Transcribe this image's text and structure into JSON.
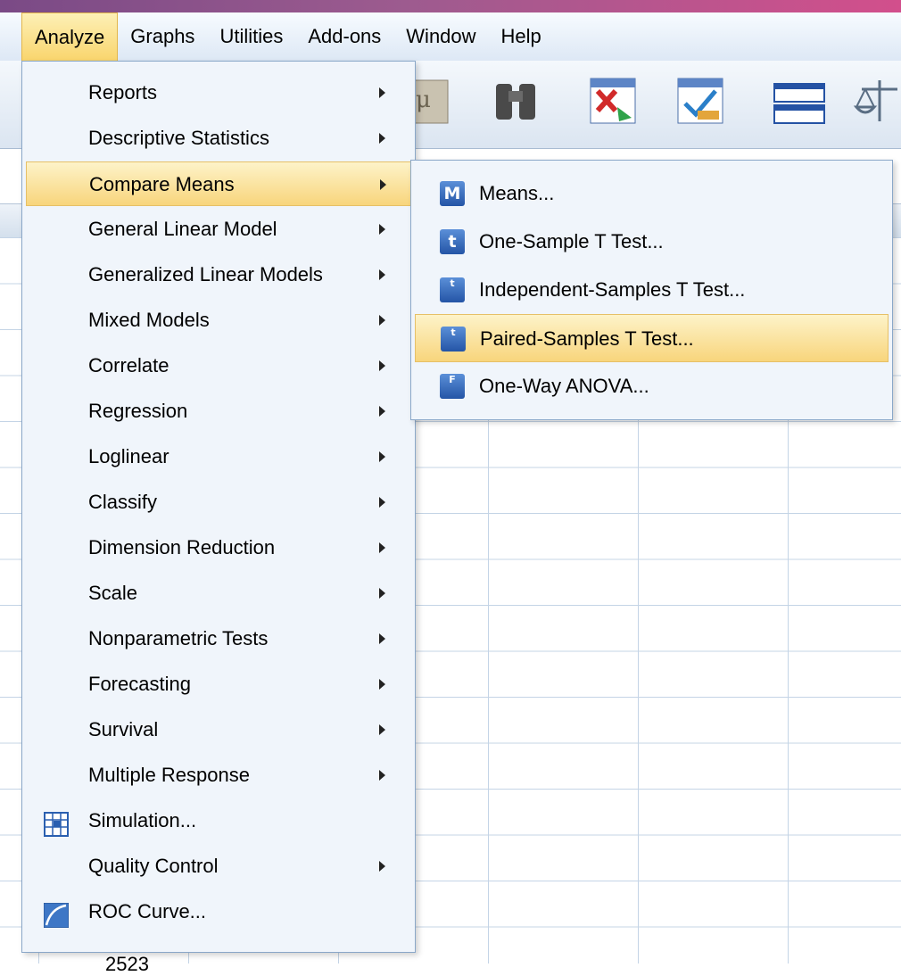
{
  "menubar": {
    "items": [
      {
        "label": "Analyze",
        "active": true
      },
      {
        "label": "Graphs"
      },
      {
        "label": "Utilities"
      },
      {
        "label": "Add-ons"
      },
      {
        "label": "Window"
      },
      {
        "label": "Help"
      }
    ]
  },
  "toolbar": {
    "icons": [
      "value-labels-icon",
      "find-icon",
      "delete-cases-icon",
      "select-cases-icon",
      "table-icon",
      "weight-cases-icon"
    ]
  },
  "analyze_menu": {
    "items": [
      {
        "label": "Reports",
        "submenu": true
      },
      {
        "label": "Descriptive Statistics",
        "submenu": true
      },
      {
        "label": "Compare Means",
        "submenu": true,
        "highlighted": true
      },
      {
        "label": "General Linear Model",
        "submenu": true
      },
      {
        "label": "Generalized Linear Models",
        "submenu": true
      },
      {
        "label": "Mixed Models",
        "submenu": true
      },
      {
        "label": "Correlate",
        "submenu": true
      },
      {
        "label": "Regression",
        "submenu": true
      },
      {
        "label": "Loglinear",
        "submenu": true
      },
      {
        "label": "Classify",
        "submenu": true
      },
      {
        "label": "Dimension Reduction",
        "submenu": true
      },
      {
        "label": "Scale",
        "submenu": true
      },
      {
        "label": "Nonparametric Tests",
        "submenu": true
      },
      {
        "label": "Forecasting",
        "submenu": true
      },
      {
        "label": "Survival",
        "submenu": true
      },
      {
        "label": "Multiple Response",
        "submenu": true
      },
      {
        "label": "Simulation...",
        "icon": "simulation-icon"
      },
      {
        "label": "Quality Control",
        "submenu": true
      },
      {
        "label": "ROC Curve...",
        "icon": "roc-curve-icon"
      }
    ]
  },
  "compare_means_submenu": {
    "items": [
      {
        "label": "Means...",
        "icon": "means-icon",
        "glyph": "M"
      },
      {
        "label": "One-Sample T Test...",
        "icon": "one-sample-t-test-icon",
        "glyph": "t"
      },
      {
        "label": "Independent-Samples T Test...",
        "icon": "independent-samples-t-test-icon",
        "glyph": "t"
      },
      {
        "label": "Paired-Samples T Test...",
        "icon": "paired-samples-t-test-icon",
        "glyph": "t",
        "highlighted": true
      },
      {
        "label": "One-Way ANOVA...",
        "icon": "one-way-anova-icon",
        "glyph": "F"
      }
    ]
  },
  "grid": {
    "visible_row_number": "2523"
  },
  "colors": {
    "highlight": "#f8d57c",
    "menu_background": "#f0f5fb",
    "menu_border": "#8aa7c8"
  }
}
